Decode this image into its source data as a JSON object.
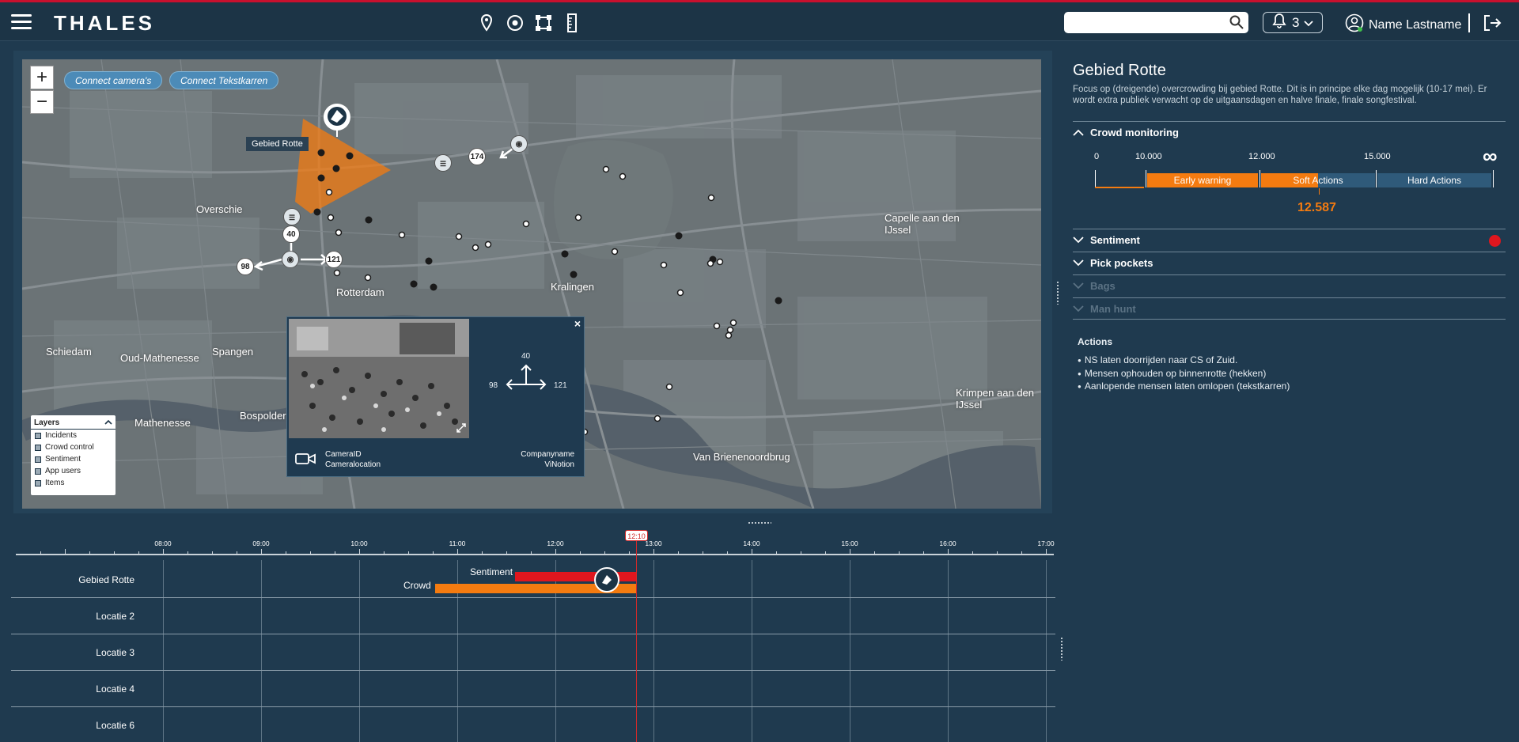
{
  "header": {
    "brand": "THALES",
    "search_placeholder": "",
    "notifications_count": "3",
    "user_name": "Name Lastname",
    "tool_icons": [
      "map-pin-icon",
      "target-icon",
      "area-select-icon",
      "ruler-icon"
    ]
  },
  "map": {
    "zoom_in": "+",
    "zoom_out": "−",
    "connect_cameras": "Connect camera's",
    "connect_textcarts": "Connect Tekstkarren",
    "area_label": "Gebied Rotte",
    "places": [
      {
        "name": "Overschie"
      },
      {
        "name": "Capelle aan den IJssel"
      },
      {
        "name": "Kralingen"
      },
      {
        "name": "Schiedam"
      },
      {
        "name": "Oud-Mathenesse"
      },
      {
        "name": "Spangen"
      },
      {
        "name": "Mathenesse"
      },
      {
        "name": "Bospolder"
      },
      {
        "name": "Krimpen aan den IJssel"
      },
      {
        "name": "Van Brienenoordbrug"
      },
      {
        "name": "Rotterdam"
      }
    ],
    "camera_counts": {
      "north": "40",
      "west": "98",
      "east": "121",
      "north_east": "174"
    },
    "layers": {
      "title": "Layers",
      "items": [
        "Incidents",
        "Crowd control",
        "Sentiment",
        "App users",
        "Items"
      ]
    },
    "camera_popup": {
      "count_north": "40",
      "count_west": "98",
      "count_east": "121",
      "camera_id": "CameraID",
      "camera_location": "Cameralocation",
      "company_name": "Companyname",
      "company": "ViNotion",
      "close": "×"
    }
  },
  "info": {
    "title": "Gebied Rotte",
    "description": "Focus op (dreigende) overcrowding bij gebied Rotte. Dit is in principe elke dag mogelijk (10-17 mei). Er wordt extra publiek verwacht op de uitgaansdagen en halve finale, finale songfestival.",
    "sections": [
      {
        "label": "Crowd monitoring",
        "expanded": true,
        "dim": false
      },
      {
        "label": "Sentiment",
        "expanded": false,
        "dim": false
      },
      {
        "label": "Pick pockets",
        "expanded": false,
        "dim": false
      },
      {
        "label": "Bags",
        "expanded": false,
        "dim": true
      },
      {
        "label": "Man hunt",
        "expanded": false,
        "dim": true
      }
    ],
    "gauge": {
      "ticks": [
        "0",
        "10.000",
        "12.000",
        "15.000",
        "∞"
      ],
      "segments": [
        "Early warning",
        "Soft Actions",
        "Hard Actions"
      ],
      "current_value": "12.587",
      "current_value_number": 12587,
      "colors": {
        "active": "#f47b10",
        "inactive": "#2f5a7a"
      }
    },
    "sentiment_status_color": "#e0161e",
    "actions": {
      "title": "Actions",
      "items": [
        "NS laten doorrijden naar CS of Zuid.",
        "Mensen ophouden op binnenrotte (hekken)",
        "Aanlopende mensen laten omlopen (tekstkarren)"
      ]
    }
  },
  "timeline": {
    "hours": [
      "08:00",
      "09:00",
      "10:00",
      "11:00",
      "12:00",
      "13:00",
      "14:00",
      "15:00",
      "16:00",
      "17:00"
    ],
    "now": "12:10",
    "rows": [
      "Gebied Rotte",
      "Locatie 2",
      "Locatie 3",
      "Locatie 4",
      "Locatie 6"
    ],
    "bars": [
      {
        "label": "Sentiment",
        "start": "11:35",
        "end": "12:10",
        "color": "#e0161e"
      },
      {
        "label": "Crowd",
        "start": "10:50",
        "end": "12:10",
        "color": "#f47b10"
      }
    ]
  }
}
